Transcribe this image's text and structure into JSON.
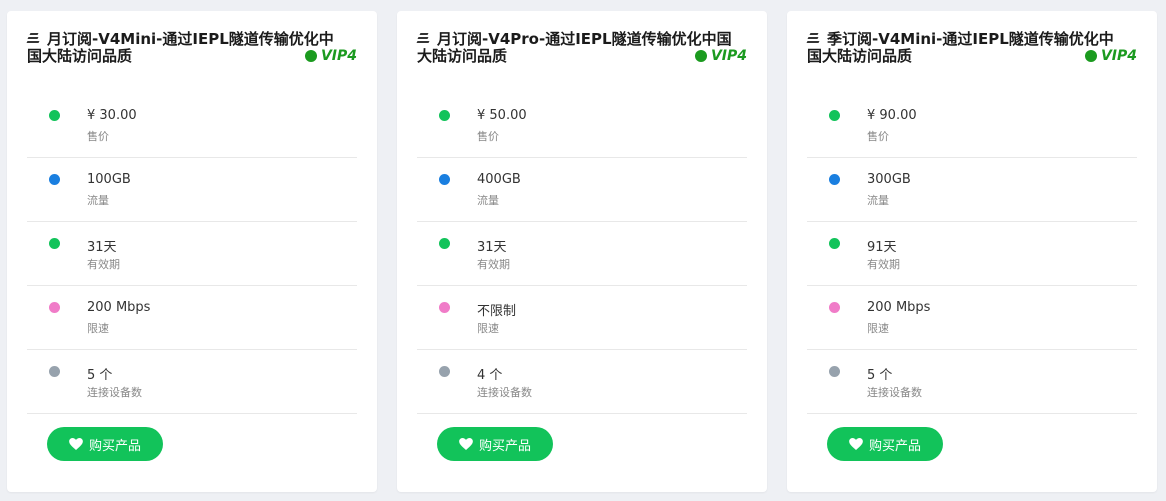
{
  "colors": {
    "green": "#12c35a",
    "blue": "#1a7fe0",
    "pink": "#f07cc8",
    "gray": "#97a2ad",
    "vip": "#1b9a1f"
  },
  "cards": [
    {
      "title": "月订阅-V4Mini-通过IEPL隧道传输优化中国大陆访问品质",
      "vip": "VIP4",
      "rows": [
        {
          "value": "¥ 30.00",
          "label": "售价",
          "color": "#12c35a"
        },
        {
          "value": "100GB",
          "label": "流量",
          "color": "#1a7fe0"
        },
        {
          "value": "31天",
          "label": "有效期",
          "color": "#12c35a"
        },
        {
          "value": "200 Mbps",
          "label": "限速",
          "color": "#f07cc8"
        },
        {
          "value": "5 个",
          "label": "连接设备数",
          "color": "#97a2ad"
        }
      ],
      "buy_label": "购买产品"
    },
    {
      "title": "月订阅-V4Pro-通过IEPL隧道传输优化中国大陆访问品质",
      "vip": "VIP4",
      "rows": [
        {
          "value": "¥ 50.00",
          "label": "售价",
          "color": "#12c35a"
        },
        {
          "value": "400GB",
          "label": "流量",
          "color": "#1a7fe0"
        },
        {
          "value": "31天",
          "label": "有效期",
          "color": "#12c35a"
        },
        {
          "value": "不限制",
          "label": "限速",
          "color": "#f07cc8"
        },
        {
          "value": "4 个",
          "label": "连接设备数",
          "color": "#97a2ad"
        }
      ],
      "buy_label": "购买产品"
    },
    {
      "title": "季订阅-V4Mini-通过IEPL隧道传输优化中国大陆访问品质",
      "vip": "VIP4",
      "rows": [
        {
          "value": "¥ 90.00",
          "label": "售价",
          "color": "#12c35a"
        },
        {
          "value": "300GB",
          "label": "流量",
          "color": "#1a7fe0"
        },
        {
          "value": "91天",
          "label": "有效期",
          "color": "#12c35a"
        },
        {
          "value": "200 Mbps",
          "label": "限速",
          "color": "#f07cc8"
        },
        {
          "value": "5 个",
          "label": "连接设备数",
          "color": "#97a2ad"
        }
      ],
      "buy_label": "购买产品"
    }
  ]
}
